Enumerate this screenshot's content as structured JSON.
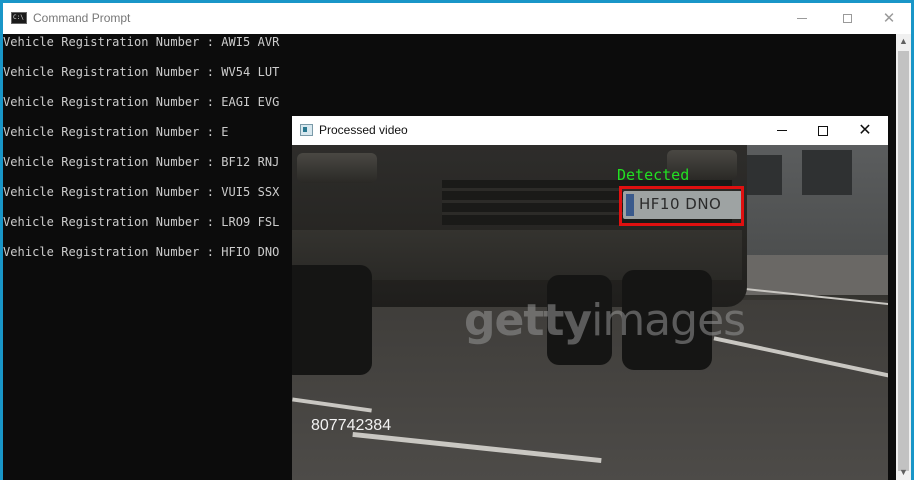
{
  "cmd": {
    "title": "Command Prompt",
    "icon": "cmd-icon",
    "icon_text": "C:\\",
    "lines": [
      "Vehicle Registration Number : AWI5 AVR",
      "Vehicle Registration Number : WV54 LUT",
      "Vehicle Registration Number : EAGI EVG",
      "Vehicle Registration Number : E",
      "Vehicle Registration Number : BF12 RNJ",
      "Vehicle Registration Number : VUI5 SSX",
      "Vehicle Registration Number : LRO9 FSL",
      "Vehicle Registration Number : HFIO DNO"
    ]
  },
  "video": {
    "title": "Processed video",
    "detected_label": "Detected",
    "plate_text": "HF10 DNO",
    "watermark_bold": "getty",
    "watermark_light": "images",
    "frame_number": "807742384"
  },
  "colors": {
    "desktop": "#1996c8",
    "console_bg": "#0c0c0c",
    "console_text": "#cccccc",
    "detect_box": "#e01010",
    "detect_label": "#22e022"
  }
}
